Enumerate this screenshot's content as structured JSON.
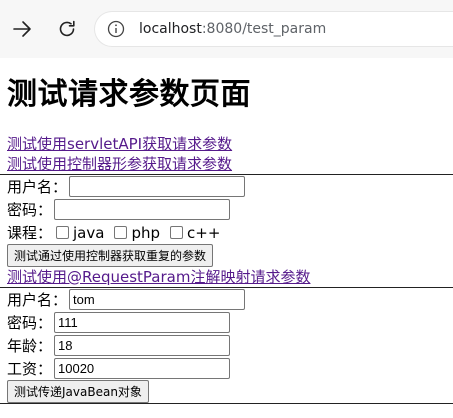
{
  "browser": {
    "url_host": "localhost",
    "url_rest": ":8080/test_param"
  },
  "page": {
    "title": "测试请求参数页面",
    "links": [
      "测试使用servletAPI获取请求参数",
      "测试使用控制器形参获取请求参数"
    ]
  },
  "form1": {
    "username_label": "用户名：",
    "username_value": "",
    "password_label": "密码：",
    "password_value": "",
    "course_label": "课程：",
    "courses": [
      "java",
      "php",
      "c++"
    ],
    "submit_label": "测试通过使用控制器获取重复的参数"
  },
  "link3": "测试使用@RequestParam注解映射请求参数",
  "form2": {
    "username_label": "用户名：",
    "username_value": "tom",
    "password_label": "密码：",
    "password_value": "111",
    "age_label": "年龄：",
    "age_value": "18",
    "salary_label": "工资：",
    "salary_value": "10020",
    "submit_label": "测试传递JavaBean对象"
  }
}
